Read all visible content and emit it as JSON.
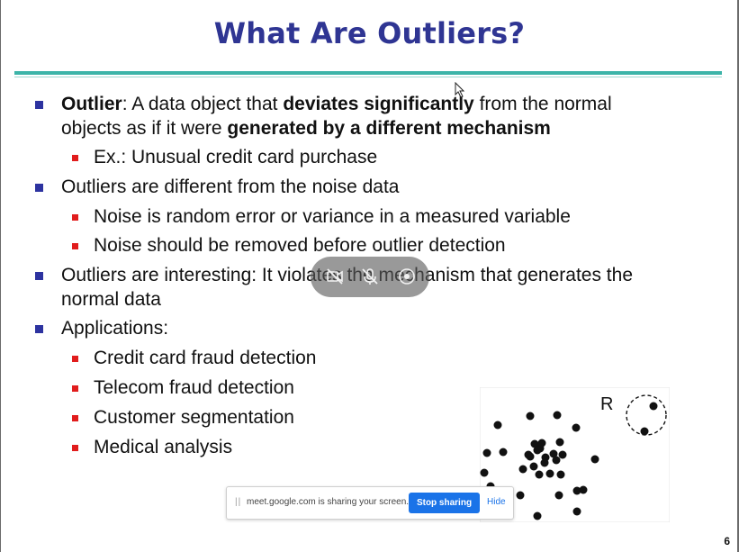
{
  "slide": {
    "title": "What Are Outliers?",
    "page_number": "6",
    "bullets": [
      {
        "level": 1,
        "lines": [
          [
            {
              "t": "Outlier",
              "b": true
            },
            {
              "t": ": A data object that ",
              "b": false
            },
            {
              "t": "deviates significantly",
              "b": true
            },
            {
              "t": " from the normal",
              "b": false
            }
          ],
          [
            {
              "t": "objects as if it were ",
              "b": false
            },
            {
              "t": "generated by a different mechanism",
              "b": true
            }
          ]
        ]
      },
      {
        "level": 2,
        "lines": [
          [
            {
              "t": "Ex.:  Unusual credit card purchase",
              "b": false
            }
          ]
        ]
      },
      {
        "level": 1,
        "lines": [
          [
            {
              "t": "Outliers are different from the noise data",
              "b": false
            }
          ]
        ]
      },
      {
        "level": 2,
        "lines": [
          [
            {
              "t": "Noise is random error or variance in a measured variable",
              "b": false
            }
          ]
        ]
      },
      {
        "level": 2,
        "lines": [
          [
            {
              "t": "Noise should be removed before outlier detection",
              "b": false
            }
          ]
        ]
      },
      {
        "level": 1,
        "lines": [
          [
            {
              "t": "Outliers are interesting:  It violates the mechanism that generates the",
              "b": false
            }
          ],
          [
            {
              "t": "normal data",
              "b": false
            }
          ]
        ]
      },
      {
        "level": 1,
        "lines": [
          [
            {
              "t": "Applications:",
              "b": false
            }
          ]
        ]
      },
      {
        "level": 2,
        "lines": [
          [
            {
              "t": "Credit card fraud detection",
              "b": false
            }
          ]
        ]
      },
      {
        "level": 2,
        "lines": [
          [
            {
              "t": "Telecom fraud detection",
              "b": false
            }
          ]
        ]
      },
      {
        "level": 2,
        "lines": [
          [
            {
              "t": "Customer segmentation",
              "b": false
            }
          ]
        ]
      },
      {
        "level": 2,
        "lines": [
          [
            {
              "t": "Medical analysis",
              "b": false
            }
          ]
        ]
      }
    ],
    "figure": {
      "region_label": "R",
      "point_count_main": 32,
      "point_count_outlier": 2
    }
  },
  "overlay": {
    "media_controls": {
      "icons": [
        "camera-off-icon",
        "mic-off-icon",
        "record-icon"
      ]
    },
    "share_bar": {
      "message": "meet.google.com is sharing your screen.",
      "stop_label": "Stop sharing",
      "hide_label": "Hide"
    }
  },
  "colors": {
    "title": "#2f3593",
    "level1_bullet": "#2d33a0",
    "level2_bullet": "#e11d1d",
    "rule": "#3cb4a8",
    "stop_button": "#1a73e8"
  }
}
